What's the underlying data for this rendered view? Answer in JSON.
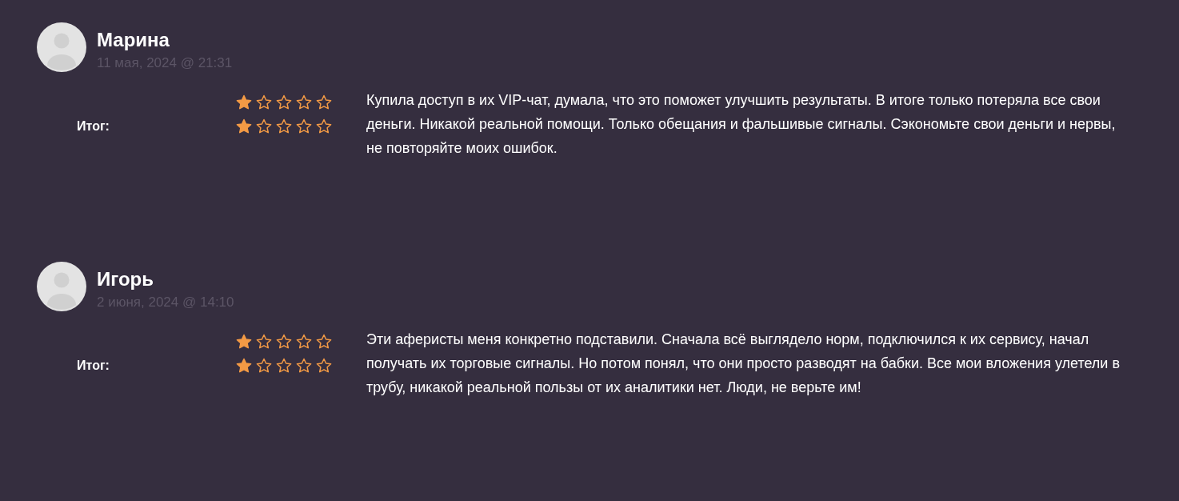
{
  "reviews": [
    {
      "name": "Марина",
      "date": "11 мая, 2024 @ 21:31",
      "ratings": [
        {
          "stars": 1
        },
        {
          "label": "Итог:",
          "stars": 1
        }
      ],
      "text": "Купила доступ в их VIP-чат, думала, что это поможет улучшить результаты. В итоге только потеряла все свои деньги. Никакой реальной помощи. Только обещания и фальшивые сигналы. Сэкономьте свои деньги и нервы, не повторяйте моих ошибок."
    },
    {
      "name": "Игорь",
      "date": "2 июня, 2024 @ 14:10",
      "ratings": [
        {
          "stars": 1
        },
        {
          "label": "Итог:",
          "stars": 1
        }
      ],
      "text": "Эти аферисты меня конкретно подставили. Сначала всё выглядело норм, подключился к их сервису, начал получать их торговые сигналы. Но потом понял, что они просто разводят на бабки. Все мои вложения улетели в трубу, никакой реальной пользы от их аналитики нет. Люди, не верьте им!"
    }
  ]
}
